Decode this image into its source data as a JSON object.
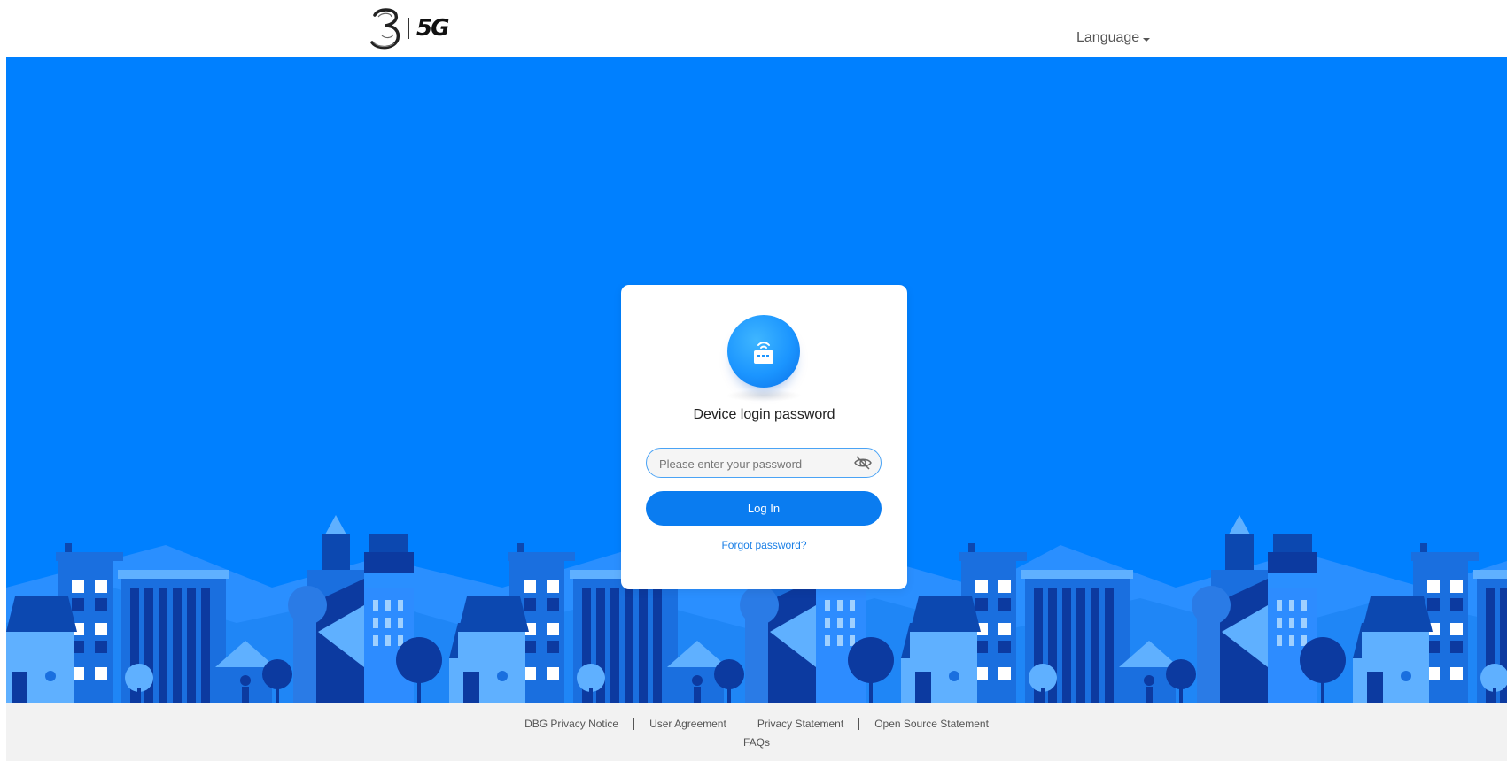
{
  "header": {
    "logo_text": "5G",
    "language_label": "Language"
  },
  "login": {
    "title": "Device login password",
    "password_placeholder": "Please enter your password",
    "password_value": "",
    "login_label": "Log In",
    "forgot_label": "Forgot password?"
  },
  "footer": {
    "links": [
      "DBG Privacy Notice",
      "User Agreement",
      "Privacy Statement",
      "Open Source Statement"
    ],
    "faq_label": "FAQs"
  },
  "colors": {
    "hero_bg": "#0080ff",
    "primary_button": "#0a7cf0",
    "link": "#1a7fe6"
  },
  "icons": {
    "router": "router-icon",
    "eye": "eye-off-icon",
    "caret": "caret-down-icon"
  }
}
